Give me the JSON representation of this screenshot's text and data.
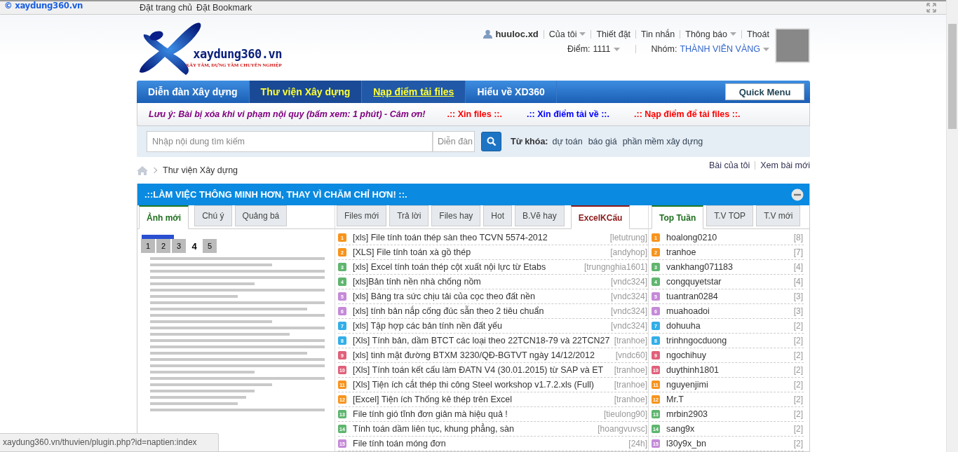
{
  "top_bar": {
    "site_label": "© xaydung360.vn",
    "links": [
      "Đặt trang chủ",
      "Đặt Bookmark"
    ]
  },
  "header": {
    "logo": {
      "name": "xaydung360.vn",
      "tagline": "XÂY TÂM, DỰNG TẦM CHUYÊN NGHIỆP"
    },
    "user": {
      "username": "huuloc.xd",
      "menu": [
        {
          "label": "Của tôi",
          "dropdown": true
        },
        {
          "label": "Thiết đặt",
          "dropdown": false
        },
        {
          "label": "Tin nhắn",
          "dropdown": false
        },
        {
          "label": "Thông báo",
          "dropdown": true
        },
        {
          "label": "Thoát",
          "dropdown": false
        }
      ],
      "points_label": "Điểm:",
      "points": "1111",
      "group_label": "Nhóm:",
      "group": "THÀNH VIÊN VÀNG"
    }
  },
  "nav": {
    "items": [
      {
        "label": "Diễn đàn Xây dựng",
        "selected": false,
        "kind": "normal"
      },
      {
        "label": "Thư viện Xây dựng",
        "selected": true,
        "kind": "normal"
      },
      {
        "label": "Nạp điểm tải files",
        "selected": false,
        "kind": "promo"
      },
      {
        "label": "Hiểu về XD360",
        "selected": false,
        "kind": "normal"
      }
    ],
    "quick_menu": "Quick Menu"
  },
  "notices": [
    {
      "text": "Lưu ý: Bài bị xóa khi vi phạm nội quy (bấm xem: 1 phút) - Cảm ơn!",
      "color": "#800080"
    },
    {
      "text": ".:: Xin files ::.",
      "color": "#ff0000"
    },
    {
      "text": ".:: Xin điểm tải về ::.",
      "color": "#0000ff"
    },
    {
      "text": ".:: Nạp điểm để tải files ::.",
      "color": "#ff0000"
    }
  ],
  "search": {
    "placeholder": "Nhập nội dung tìm kiếm",
    "scope": "Diễn đàn",
    "keywords_label": "Từ khóa:",
    "keywords": [
      "dự toán",
      "báo giá",
      "phần mềm xây dựng"
    ]
  },
  "breadcrumb": {
    "items": [
      "Thư viện Xây dựng"
    ],
    "links": [
      "Bài của tôi",
      "Xem bài mới"
    ]
  },
  "panel": {
    "title": ".::LÀM VIỆC THÔNG MINH HƠN, THAY VÌ CHĂM CHỈ HƠN! ::.",
    "left": {
      "tabs": [
        {
          "label": "Ảnh mới",
          "selected": true
        },
        {
          "label": "Chú ý",
          "selected": false
        },
        {
          "label": "Quảng bá",
          "selected": false
        }
      ],
      "slides": [
        {
          "label": "1",
          "selected": false
        },
        {
          "label": "2",
          "selected": false
        },
        {
          "label": "3",
          "selected": false
        },
        {
          "label": "4",
          "selected": true
        },
        {
          "label": "5",
          "selected": false
        }
      ]
    },
    "middle": {
      "tabs": [
        {
          "label": "Files mới",
          "selected": false
        },
        {
          "label": "Trả lời",
          "selected": false
        },
        {
          "label": "Files hay",
          "selected": false
        },
        {
          "label": "Hot",
          "selected": false
        },
        {
          "label": "B.Vẽ hay",
          "selected": false
        },
        {
          "label": "ExcelKCấu",
          "selected": true
        }
      ],
      "rows": [
        {
          "rank": "1",
          "title": "[xls] File tính toán thép sàn theo TCVN 5574-2012",
          "author": "[letutrung]",
          "color": "#f7941d"
        },
        {
          "rank": "2",
          "title": "[XLS] File tính toán xà gồ thép",
          "author": "[andyhop]",
          "color": "#f7941d"
        },
        {
          "rank": "3",
          "title": "[xls] Excel tính toán thép cột xuất nội lực từ Etabs",
          "author": "[trungnghia1601]",
          "color": "#5fb56f"
        },
        {
          "rank": "4",
          "title": "[xls]Bản tính nền nhà chống nồm",
          "author": "[vndc324]",
          "color": "#5fb56f"
        },
        {
          "rank": "5",
          "title": "[xls] Bảng tra sức chịu tải của cọc theo đất nền",
          "author": "[vndc324]",
          "color": "#c58ad8"
        },
        {
          "rank": "6",
          "title": "[xls] tính bản nắp cống đúc sẵn theo 2 tiêu chuẩn",
          "author": "[vndc324]",
          "color": "#c58ad8"
        },
        {
          "rank": "7",
          "title": "[xls] Tập hợp các bản tính nền đất yếu",
          "author": "[vndc324]",
          "color": "#33aee8"
        },
        {
          "rank": "8",
          "title": "[Xls] Tính bản, dầm BTCT các loại theo 22TCN18-79 và 22TCN27",
          "author": "[tranhoe]",
          "color": "#33aee8"
        },
        {
          "rank": "9",
          "title": "[xls] tinh mặt đường BTXM 3230/QĐ-BGTVT ngày 14/12/2012",
          "author": "[vndc60]",
          "color": "#e0607a"
        },
        {
          "rank": "10",
          "title": "[Xls] Tính toán kết cấu làm ĐATN V4 (30.01.2015) từ SAP và ET",
          "author": "[tranhoe]",
          "color": "#e0607a"
        },
        {
          "rank": "11",
          "title": "[Xls] Tiện ích cắt thép thi công Steel workshop v1.7.2.xls (Full)",
          "author": "[tranhoe]",
          "color": "#f7941d"
        },
        {
          "rank": "12",
          "title": "[Excel] Tiện ích Thống kê thép trên Excel",
          "author": "[tranhoe]",
          "color": "#f7941d"
        },
        {
          "rank": "13",
          "title": "File tính gió tĩnh đơn giản mà hiệu quả !",
          "author": "[tieulong90]",
          "color": "#5fb56f"
        },
        {
          "rank": "14",
          "title": "Tính toán dầm liên tục, khung phẳng, sàn",
          "author": "[hoangvuvsc]",
          "color": "#5fb56f"
        },
        {
          "rank": "15",
          "title": "File tính toán móng đơn",
          "author": "[24h]",
          "color": "#c58ad8"
        }
      ]
    },
    "right": {
      "tabs": [
        {
          "label": "Top Tuần",
          "selected": true
        },
        {
          "label": "T.V TOP",
          "selected": false
        },
        {
          "label": "T.V mới",
          "selected": false
        }
      ],
      "rows": [
        {
          "rank": "1",
          "name": "hoalong0210",
          "count": "[8]",
          "color": "#f7941d"
        },
        {
          "rank": "2",
          "name": "tranhoe",
          "count": "[7]",
          "color": "#f7941d"
        },
        {
          "rank": "3",
          "name": "vankhang071183",
          "count": "[4]",
          "color": "#5fb56f"
        },
        {
          "rank": "4",
          "name": "congquyetstar",
          "count": "[4]",
          "color": "#5fb56f"
        },
        {
          "rank": "5",
          "name": "tuantran0284",
          "count": "[3]",
          "color": "#c58ad8"
        },
        {
          "rank": "6",
          "name": "muahoadoi",
          "count": "[3]",
          "color": "#c58ad8"
        },
        {
          "rank": "7",
          "name": "dohuuha",
          "count": "[2]",
          "color": "#33aee8"
        },
        {
          "rank": "8",
          "name": "trinhngocduong",
          "count": "[2]",
          "color": "#33aee8"
        },
        {
          "rank": "9",
          "name": "ngochihuy",
          "count": "[2]",
          "color": "#e0607a"
        },
        {
          "rank": "10",
          "name": "duythinh1801",
          "count": "[2]",
          "color": "#e0607a"
        },
        {
          "rank": "11",
          "name": "nguyenjimi",
          "count": "[2]",
          "color": "#f7941d"
        },
        {
          "rank": "12",
          "name": "Mr.T",
          "count": "[2]",
          "color": "#f7941d"
        },
        {
          "rank": "13",
          "name": "mrbin2903",
          "count": "[2]",
          "color": "#5fb56f"
        },
        {
          "rank": "14",
          "name": "sang9x",
          "count": "[2]",
          "color": "#5fb56f"
        },
        {
          "rank": "15",
          "name": "l30y9x_bn",
          "count": "[2]",
          "color": "#c58ad8"
        }
      ]
    }
  },
  "status_url": "xaydung360.vn/thuvien/plugin.php?id=naptien:index"
}
